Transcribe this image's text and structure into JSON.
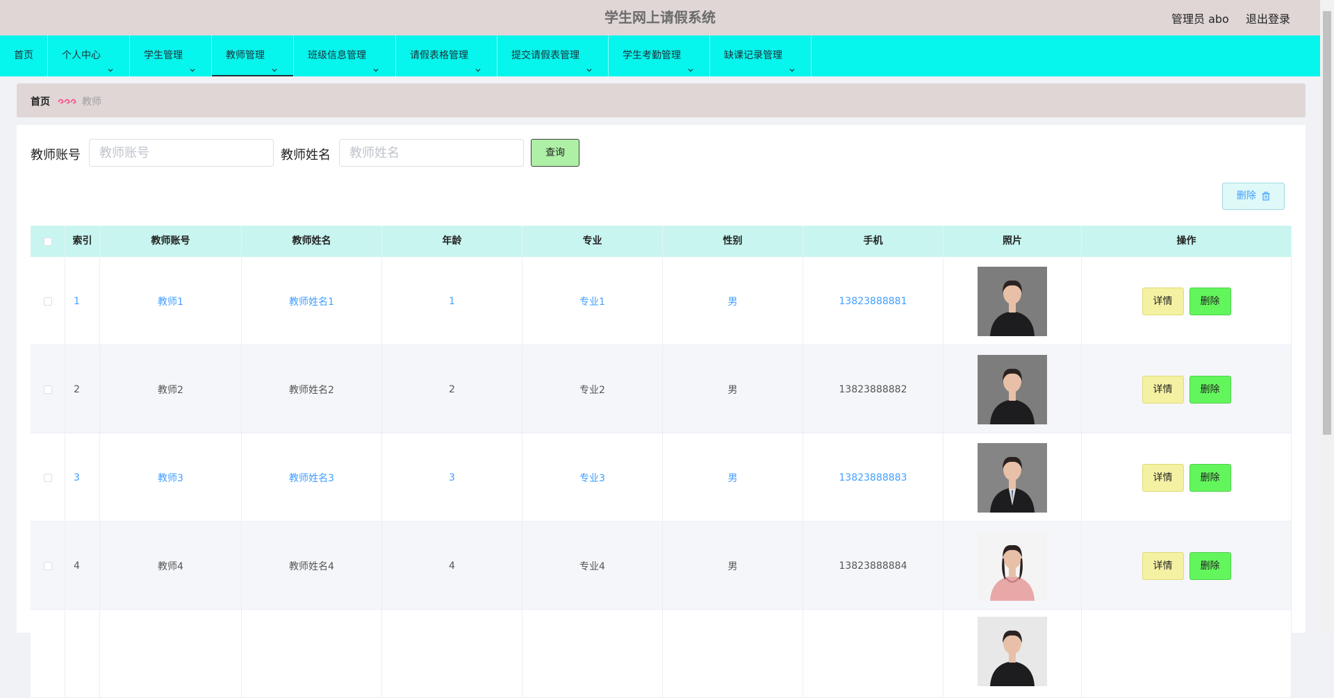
{
  "header": {
    "title": "学生网上请假系统",
    "admin_label": "管理员 abo",
    "logout": "退出登录"
  },
  "nav": [
    {
      "label": "首页",
      "dropdown": false,
      "active": false
    },
    {
      "label": "个人中心",
      "dropdown": true,
      "active": false
    },
    {
      "label": "学生管理",
      "dropdown": true,
      "active": false
    },
    {
      "label": "教师管理",
      "dropdown": true,
      "active": true
    },
    {
      "label": "班级信息管理",
      "dropdown": true,
      "active": false
    },
    {
      "label": "请假表格管理",
      "dropdown": true,
      "active": false
    },
    {
      "label": "提交请假表管理",
      "dropdown": true,
      "active": false
    },
    {
      "label": "学生考勤管理",
      "dropdown": true,
      "active": false
    },
    {
      "label": "缺课记录管理",
      "dropdown": true,
      "active": false
    }
  ],
  "breadcrumb": {
    "home": "首页",
    "current": "教师"
  },
  "search": {
    "account_label": "教师账号",
    "account_placeholder": "教师账号",
    "name_label": "教师姓名",
    "name_placeholder": "教师姓名",
    "query_button": "查询"
  },
  "bulk_delete": "删除",
  "table": {
    "headers": [
      "索引",
      "教师账号",
      "教师姓名",
      "年龄",
      "专业",
      "性别",
      "手机",
      "照片",
      "操作"
    ],
    "rows": [
      {
        "index": "1",
        "account": "教师1",
        "name": "教师姓名1",
        "age": "1",
        "major": "专业1",
        "gender": "男",
        "phone": "13823888881",
        "highlight": true
      },
      {
        "index": "2",
        "account": "教师2",
        "name": "教师姓名2",
        "age": "2",
        "major": "专业2",
        "gender": "男",
        "phone": "13823888882",
        "highlight": false
      },
      {
        "index": "3",
        "account": "教师3",
        "name": "教师姓名3",
        "age": "3",
        "major": "专业3",
        "gender": "男",
        "phone": "13823888883",
        "highlight": true
      },
      {
        "index": "4",
        "account": "教师4",
        "name": "教师姓名4",
        "age": "4",
        "major": "专业4",
        "gender": "男",
        "phone": "13823888884",
        "highlight": false
      },
      {
        "index": "",
        "account": "",
        "name": "",
        "age": "",
        "major": "",
        "gender": "",
        "phone": "",
        "highlight": false
      }
    ],
    "detail_button": "详情",
    "delete_button": "删除"
  },
  "colors": {
    "header_bg": "#e0d6d6",
    "nav_bg": "#06f5ec",
    "link_blue": "#409eff",
    "table_head_bg": "#c8f5ef",
    "detail_btn": "#f5f1a3",
    "delete_btn": "#63f65c",
    "query_btn": "#aef0a6"
  }
}
